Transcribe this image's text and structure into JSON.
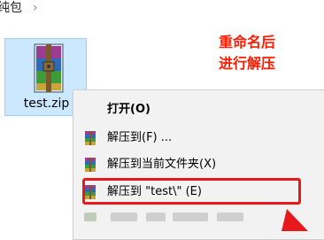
{
  "breadcrumb": {
    "text": "纯包",
    "separator": "›"
  },
  "file": {
    "name": "test.zip",
    "icon": "winrar-archive-icon"
  },
  "annotation": {
    "line1": "重命名后",
    "line2": "进行解压"
  },
  "context_menu": {
    "items": [
      {
        "label": "打开(O)",
        "icon": ""
      },
      {
        "label": "解压到(F) ...",
        "icon": "winrar-icon"
      },
      {
        "label": "解压到当前文件夹(X)",
        "icon": "winrar-icon"
      },
      {
        "label": "解压到 \"test\\\" (E)",
        "icon": "winrar-icon"
      }
    ]
  },
  "colors": {
    "highlight": "#e8191c",
    "annotation": "#ff1a00",
    "selection": "#cce8ff"
  }
}
